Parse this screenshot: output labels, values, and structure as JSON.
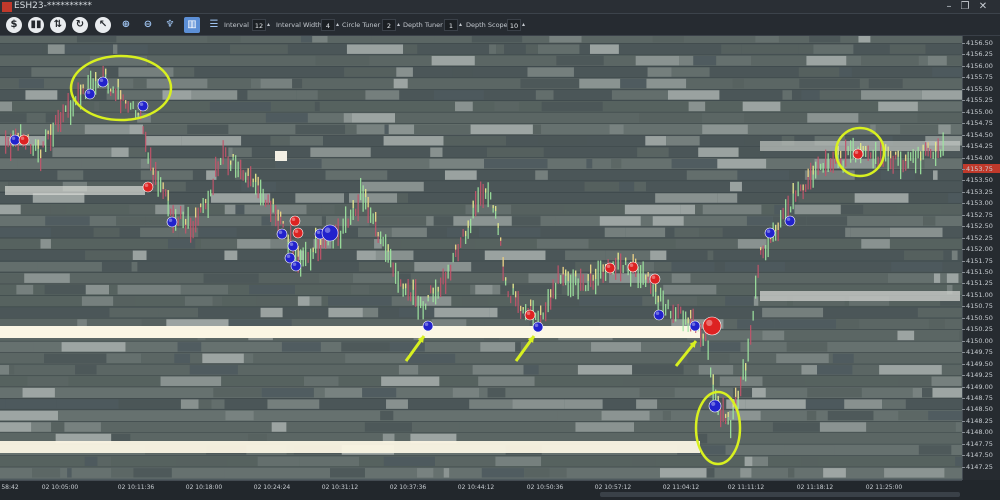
{
  "window": {
    "title": "ESH23-**********",
    "minimize": "–",
    "restore": "❐",
    "close": "✕"
  },
  "toolbar": {
    "icons": [
      "dollar-icon",
      "bar-chart-icon",
      "up-down-arrows-icon",
      "refresh-icon",
      "cursor-icon",
      "zoom-in-icon",
      "zoom-out-icon",
      "tooth-icon",
      "columns-icon",
      "levels-icon"
    ],
    "glyphs": [
      "$",
      "▮▮",
      "⇅",
      "↻",
      "↖",
      "⊕",
      "⊖",
      "♆",
      "▥",
      "☰"
    ],
    "controls": [
      {
        "label": "Interval",
        "value": "12"
      },
      {
        "label": "Interval Width",
        "value": "4"
      },
      {
        "label": "Circle Tuner",
        "value": "2"
      },
      {
        "label": "Depth Tuner",
        "value": "1"
      },
      {
        "label": "Depth Scope",
        "value": "10"
      }
    ]
  },
  "price_axis": {
    "ticks": [
      "4156.50",
      "4156.25",
      "4156.00",
      "4155.75",
      "4155.50",
      "4155.25",
      "4155.00",
      "4154.75",
      "4154.50",
      "4154.25",
      "4154.00",
      "4153.75",
      "4153.50",
      "4153.25",
      "4153.00",
      "4152.75",
      "4152.50",
      "4152.25",
      "4152.00",
      "4151.75",
      "4151.50",
      "4151.25",
      "4151.00",
      "4150.75",
      "4150.50",
      "4150.25",
      "4150.00",
      "4149.75",
      "4149.50",
      "4149.25",
      "4149.00",
      "4148.75",
      "4148.50",
      "4148.25",
      "4148.00",
      "4147.75",
      "4147.50",
      "4147.25"
    ],
    "current_price_color": "#c0392b"
  },
  "time_axis": {
    "ticks": [
      "58:42",
      "02 10:05:00",
      "02 10:11:36",
      "02 10:18:00",
      "02 10:24:24",
      "02 10:31:12",
      "02 10:37:36",
      "02 10:44:12",
      "02 10:50:36",
      "02 10:57:12",
      "02 11:04:12",
      "02 11:11:12",
      "02 11:18:12",
      "02 11:25:00"
    ]
  },
  "colors": {
    "bid_bubble": "#2222cc",
    "ask_bubble": "#dd2222",
    "annotation": "#d8f020",
    "heatmap_high": "#fbf6e4",
    "heatmap_low": "#4e5a5e"
  }
}
